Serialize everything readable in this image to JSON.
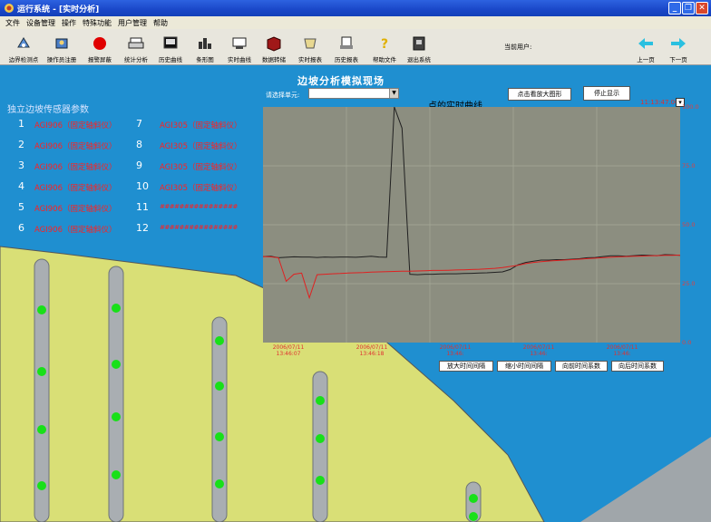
{
  "window": {
    "title": "运行系统 - [实时分析]"
  },
  "menu": [
    "文件",
    "设备管理",
    "操作",
    "特殊功能",
    "用户管理",
    "帮助"
  ],
  "toolbar": [
    {
      "label": "边界检测点",
      "icon": "measure-icon"
    },
    {
      "label": "操作员注册",
      "icon": "operator-icon"
    },
    {
      "label": "报警屏蔽",
      "icon": "alarm-stop-icon"
    },
    {
      "label": "统计分析",
      "icon": "printer-icon"
    },
    {
      "label": "历史曲线",
      "icon": "history-curve-icon"
    },
    {
      "label": "条形图",
      "icon": "bar-chart-icon"
    },
    {
      "label": "实时曲线",
      "icon": "realtime-curve-icon"
    },
    {
      "label": "数据转储",
      "icon": "book-icon"
    },
    {
      "label": "实时报表",
      "icon": "realtime-report-icon"
    },
    {
      "label": "历史报表",
      "icon": "history-report-icon"
    },
    {
      "label": "帮助文件",
      "icon": "help-icon"
    },
    {
      "label": "退出系统",
      "icon": "exit-icon"
    }
  ],
  "current_user_label": "当前用户:",
  "nav": {
    "prev": "上一页",
    "next": "下一页"
  },
  "page_title": "边坡分析模拟现场",
  "unit_select_label": "请选择单元:",
  "unit_select_value": "",
  "curve_title": "点的实时曲线",
  "buttons": {
    "enlarge": "点击看放大图形",
    "stop": "停止显示",
    "zoom_in_interval": "放大时间间隔",
    "zoom_out_interval": "缩小时间间隔",
    "move_forward": "向前时间系数",
    "move_backward": "向后时间系数"
  },
  "sensor_heading": "独立边坡传感器参数",
  "sensors_left": [
    {
      "num": "1",
      "label": "AGI906（固定轴斜仪）"
    },
    {
      "num": "2",
      "label": "AGI906（固定轴斜仪）"
    },
    {
      "num": "3",
      "label": "AGI906（固定轴斜仪）"
    },
    {
      "num": "4",
      "label": "AGI906（固定轴斜仪）"
    },
    {
      "num": "5",
      "label": "AGI906（固定轴斜仪）"
    },
    {
      "num": "6",
      "label": "AGI906（固定轴斜仪）"
    }
  ],
  "sensors_right": [
    {
      "num": "7",
      "label": "AGI305（固定轴斜仪）"
    },
    {
      "num": "8",
      "label": "AGI305（固定轴斜仪）"
    },
    {
      "num": "9",
      "label": "AGI305（固定轴斜仪）"
    },
    {
      "num": "10",
      "label": "AGI305（固定轴斜仪）"
    },
    {
      "num": "11",
      "label": "################"
    },
    {
      "num": "12",
      "label": "################"
    }
  ],
  "time_readout": "11:13:47.00",
  "colors": {
    "sky": "#1f8fd0",
    "slope": "#d9df76",
    "plot": "#8c8e80",
    "pole": "#a9aeb2",
    "led": "#18e018",
    "series_black": "#202020",
    "series_red": "#e02020"
  },
  "chart_data": {
    "type": "line",
    "x": [
      "2006/07/11 13:46:07",
      "2006/07/11 13:46:18",
      "2006/07/11 13:46:",
      "2006/07/11 13:46:",
      "2006/07/11 13:46:"
    ],
    "ylim": [
      0,
      100
    ],
    "yticks": [
      "100.0",
      "75.0",
      "50.0",
      "25.0",
      "0.0"
    ],
    "grid": true,
    "series": [
      {
        "color": "#202020",
        "values": [
          36.5,
          36.6,
          36.0,
          36.2,
          36.4,
          36.3,
          36.3,
          36.1,
          36.3,
          36.2,
          36.3,
          36.3,
          36.2,
          36.4,
          36.6,
          36.3,
          36.2,
          100,
          91,
          29,
          28.8,
          29,
          29,
          29.1,
          29.2,
          29.2,
          29.3,
          29.4,
          29.5,
          29.6,
          29.8,
          30,
          31,
          33,
          34,
          34.5,
          35,
          35,
          35.2,
          35.2,
          35.4,
          35.6,
          36,
          36.1,
          36.5,
          36.8,
          36.8,
          36.6,
          36.9,
          37.1,
          37.0,
          36.9,
          37.3,
          37.2,
          37.0
        ]
      },
      {
        "color": "#e02020",
        "values": [
          36.5,
          36.4,
          36.0,
          26.0,
          29.0,
          29.5,
          19.0,
          28.8,
          29.0,
          29.2,
          29.3,
          29.5,
          29.6,
          29.7,
          29.9,
          30.0,
          30.1,
          30.2,
          30.3,
          30.3,
          30.4,
          30.5,
          30.6,
          30.6,
          30.7,
          30.8,
          30.9,
          31.0,
          31.1,
          31.3,
          31.5,
          31.8,
          32.3,
          32.8,
          33.5,
          34.0,
          34.3,
          34.6,
          34.8,
          35.0,
          35.2,
          35.4,
          35.6,
          35.8,
          36.0,
          36.2,
          36.4,
          36.5,
          36.6,
          36.7,
          36.8,
          36.9,
          37.0,
          37.0,
          37.1
        ]
      }
    ]
  }
}
